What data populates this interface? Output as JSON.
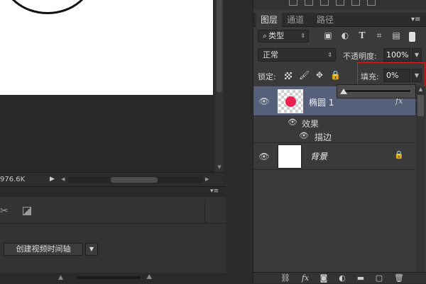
{
  "status_bar": {
    "doc_size": "976.6K"
  },
  "timeline": {
    "create_button_label": "创建视频时间轴"
  },
  "layers_panel": {
    "tabs": [
      {
        "label": "图层",
        "active": true
      },
      {
        "label": "通道",
        "active": false
      },
      {
        "label": "路径",
        "active": false
      }
    ],
    "filter": {
      "kind_label": "类型"
    },
    "blend_mode": "正常",
    "opacity_label": "不透明度:",
    "opacity_value": "100%",
    "lock_label": "锁定:",
    "fill_label": "填充:",
    "fill_value": "0%",
    "fill_slider_fraction": 0,
    "layers": [
      {
        "name": "椭圆 1",
        "thumb_color": "#ec2050",
        "has_fx": true,
        "effects_label": "效果",
        "effect_items": [
          "描边"
        ]
      },
      {
        "name": "背景",
        "locked": true
      }
    ]
  },
  "colors": {
    "selected_layer": "#56607a",
    "highlight_border": "#e02020",
    "ellipse_fill": "#ec2050"
  }
}
